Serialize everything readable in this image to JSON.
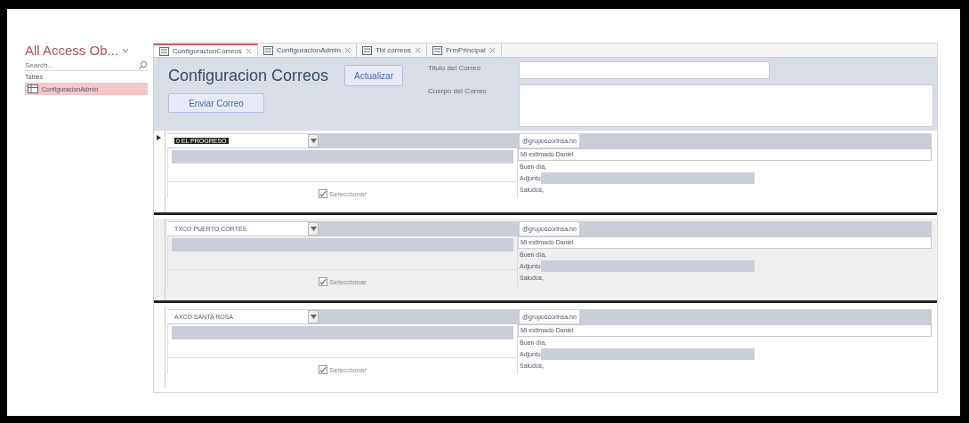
{
  "navigation_pane": {
    "title": "All Access Ob...",
    "search": {
      "placeholder": "Search..."
    },
    "groups": [
      {
        "label": "Tables",
        "items": [
          {
            "label": "ConfiguracionAdmin",
            "selected": true
          }
        ]
      }
    ]
  },
  "tabs": [
    {
      "label": "ConfiguracionCorreos",
      "selected": true
    },
    {
      "label": "ConfiguracionAdmin",
      "selected": false
    },
    {
      "label": "Tbl correos",
      "selected": false
    },
    {
      "label": "FrmPrincipal",
      "selected": false
    }
  ],
  "form": {
    "title": "Configuracion Correos",
    "buttons": {
      "refresh": "Actualizar",
      "send": "Enviar Correo"
    },
    "subject_label": "Titulo del Correo",
    "body_label": "Cuerpo del Correo"
  },
  "records": [
    {
      "name": "0 EL PROGRESO",
      "current": true,
      "email_domain": "@gruposcorinsa.hn",
      "greeting": "Mi estimado Daniel",
      "lines": [
        "Buen día,",
        "Adjunto",
        "Saludos,"
      ],
      "checkbox": {
        "label": "Seleccionar",
        "checked": true
      }
    },
    {
      "name": "TXCO PUERTO CORTES",
      "current": false,
      "email_domain": "@gruposcorinsa.hn",
      "greeting": "Mi estimado Daniel",
      "lines": [
        "Buen día,",
        "Adjunto",
        "Saludos,"
      ],
      "checkbox": {
        "label": "Seleccionar",
        "checked": true
      }
    },
    {
      "name": "AXCO SANTA ROSA",
      "current": false,
      "email_domain": "@gruposcorinsa.hn",
      "greeting": "Mi estimado Daniel",
      "lines": [
        "Buen día,",
        "Adjunto",
        "Saludos,"
      ],
      "checkbox": {
        "label": "Seleccionar",
        "checked": true
      }
    }
  ]
}
